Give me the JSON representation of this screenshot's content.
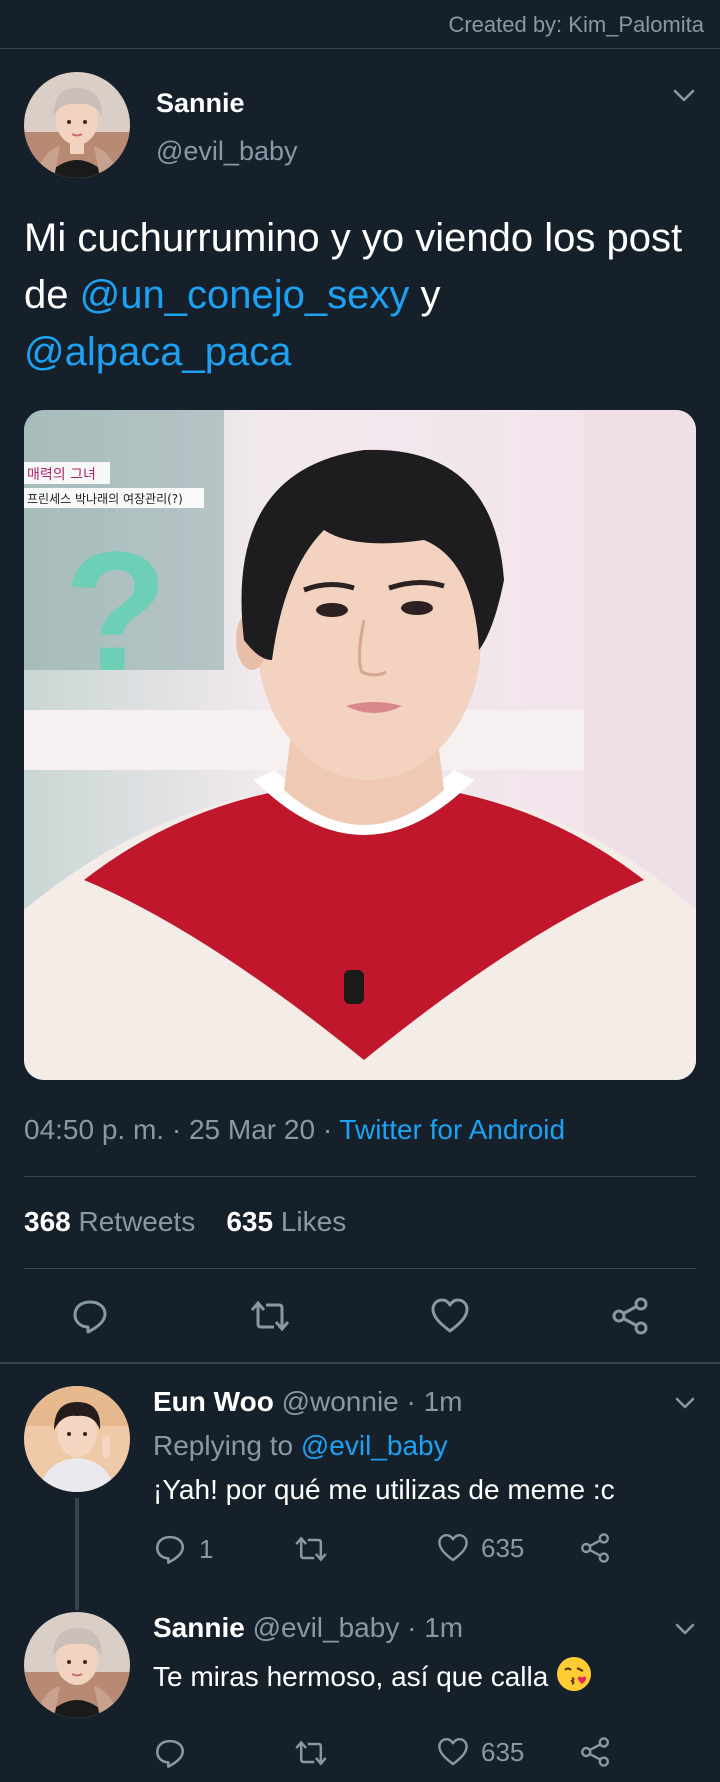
{
  "credit": "Created by: Kim_Palomita",
  "main_tweet": {
    "name": "Sannie",
    "handle": "@evil_baby",
    "text_before": "Mi cuchurrumino y yo viendo los post de ",
    "mention1": "@un_conejo_sexy",
    "text_middle": " y ",
    "mention2": "@alpaca_paca",
    "image_caption_line1": "매력의 그녀",
    "image_caption_line2": "프린세스 박나래의 여장관리(?)",
    "time_date": "04:50 p. m. · 25 Mar 20 · ",
    "source": "Twitter for Android",
    "retweets_count": "368",
    "retweets_label": " Retweets",
    "likes_count": "635",
    "likes_label": " Likes"
  },
  "replies": [
    {
      "name": "Eun Woo",
      "meta": " @wonnie · 1m",
      "replying_prefix": "Replying to ",
      "replying_handle": "@evil_baby",
      "text": "¡Yah! por qué me utilizas de meme :c",
      "reply_count": "1",
      "like_count": "635"
    },
    {
      "name": "Sannie",
      "meta": " @evil_baby · 1m",
      "text": "Te miras hermoso, así que calla",
      "emoji": "face-blowing-kiss",
      "like_count": "635"
    }
  ],
  "colors": {
    "background": "#15202b",
    "accent": "#1da1f2",
    "muted": "#8899a6",
    "divider": "#38444d"
  }
}
